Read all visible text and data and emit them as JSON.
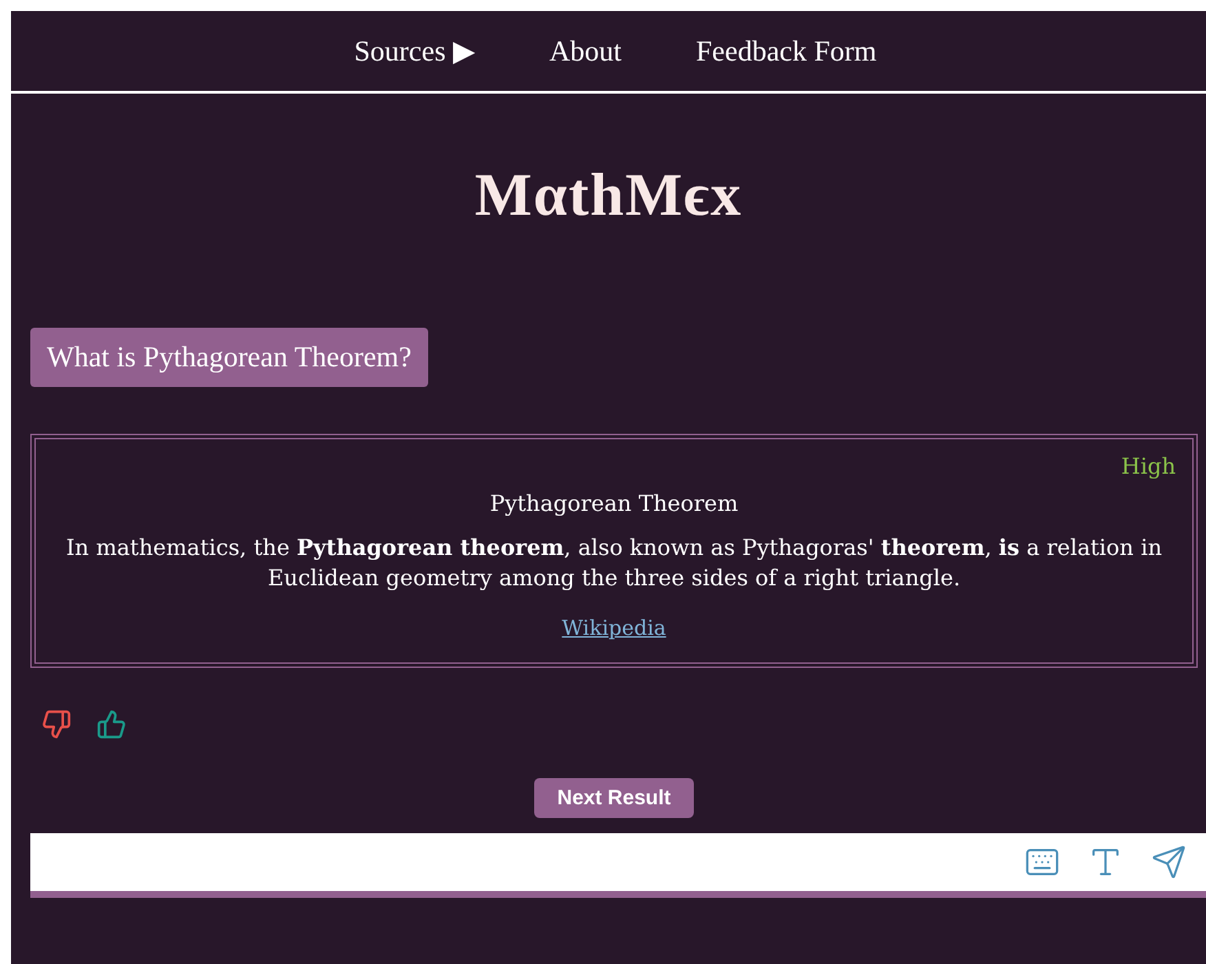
{
  "nav": {
    "items": [
      {
        "label": "Sources ▶"
      },
      {
        "label": "About"
      },
      {
        "label": "Feedback Form"
      }
    ]
  },
  "logo": "MαthMϵx",
  "query": "What is Pythagorean Theorem?",
  "result": {
    "confidence": "High",
    "title": "Pythagorean Theorem",
    "body": "In mathematics, the **Pythagorean theorem**, also known as Pythagoras' **theorem**, **is** a relation in Euclidean geometry among the three sides of a right triangle.",
    "source": "Wikipedia"
  },
  "next_button": "Next Result"
}
